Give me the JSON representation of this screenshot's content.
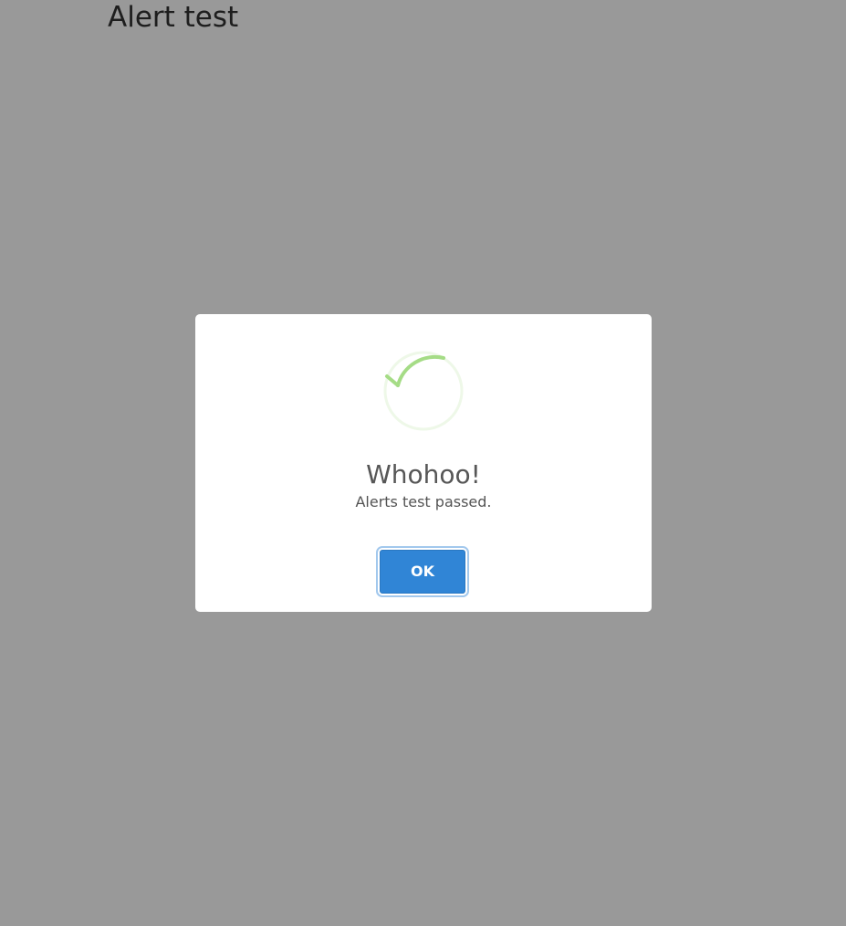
{
  "page": {
    "title": "Alert test"
  },
  "alert": {
    "icon": "success-spinner-icon",
    "title": "Whohoo!",
    "text": "Alerts test passed.",
    "confirm_label": "OK"
  },
  "colors": {
    "overlay": "rgba(0,0,0,0.4)",
    "confirm_button": "#3085d6",
    "success_accent": "#a5dc86",
    "success_ring": "#eef8e8"
  }
}
